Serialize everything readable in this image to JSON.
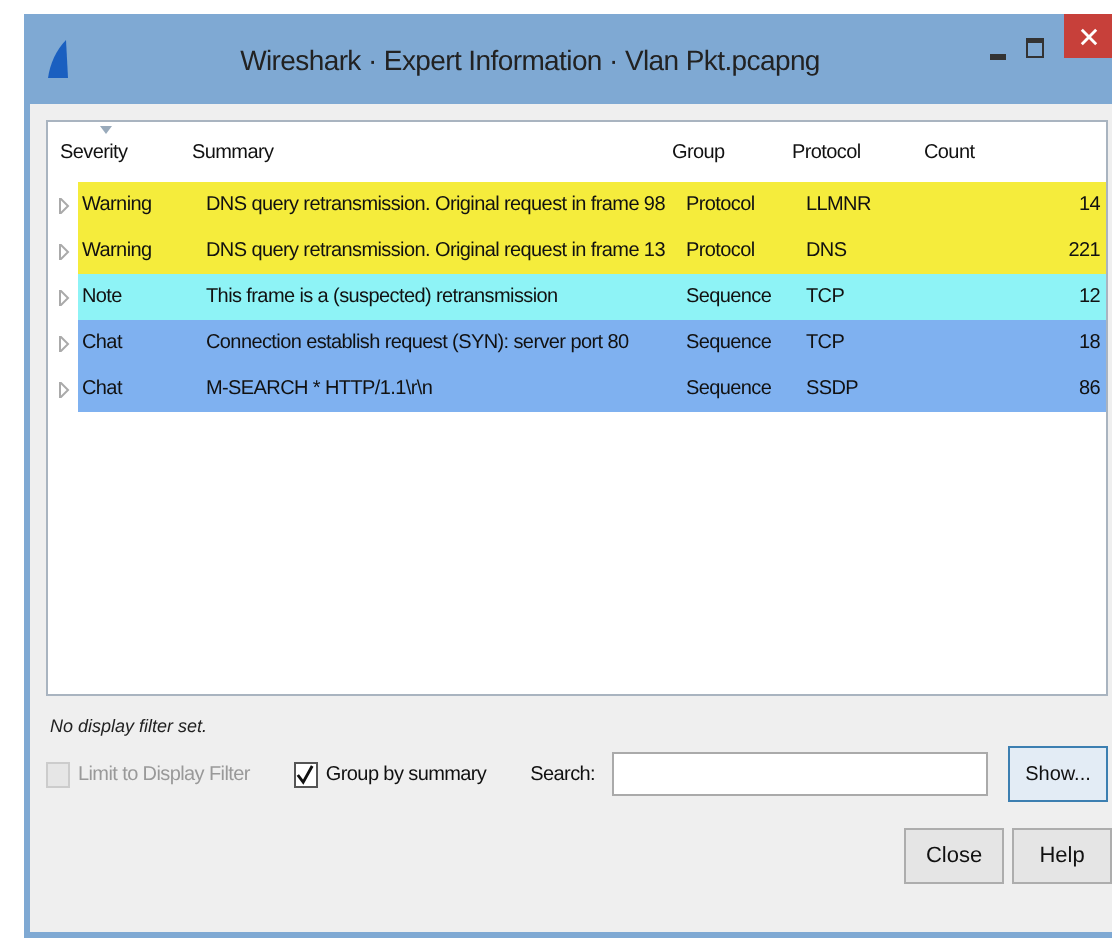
{
  "window": {
    "title": "Wireshark · Expert Information · Vlan Pkt.pcapng"
  },
  "table": {
    "columns": [
      "Severity",
      "Summary",
      "Group",
      "Protocol",
      "Count"
    ],
    "rows": [
      {
        "severity": "Warning",
        "summary": "DNS query retransmission. Original request in frame 98",
        "group": "Protocol",
        "protocol": "LLMNR",
        "count": "14",
        "color": "#f5ec3c",
        "expanded": false
      },
      {
        "severity": "Warning",
        "summary": "DNS query retransmission. Original request in frame 13",
        "group": "Protocol",
        "protocol": "DNS",
        "count": "221",
        "color": "#f5ec3c",
        "expanded": false
      },
      {
        "severity": "Note",
        "summary": "This frame is a (suspected) retransmission",
        "group": "Sequence",
        "protocol": "TCP",
        "count": "12",
        "color": "#8ef3f6",
        "expanded": false
      },
      {
        "severity": "Chat",
        "summary": "Connection establish request (SYN): server port 80",
        "group": "Sequence",
        "protocol": "TCP",
        "count": "18",
        "color": "#7fb1f0",
        "expanded": false
      },
      {
        "severity": "Chat",
        "summary": "M-SEARCH * HTTP/1.1\\r\\n",
        "group": "Sequence",
        "protocol": "SSDP",
        "count": "86",
        "color": "#7fb1f0",
        "expanded": false
      }
    ]
  },
  "filter_status": "No display filter set.",
  "limit_to_display_filter": {
    "label": "Limit to Display Filter",
    "checked": false,
    "disabled": true
  },
  "group_by_summary": {
    "label": "Group by summary",
    "checked": true,
    "disabled": false
  },
  "search": {
    "label": "Search:"
  },
  "buttons": {
    "show": "Show...",
    "close": "Close",
    "help": "Help"
  }
}
